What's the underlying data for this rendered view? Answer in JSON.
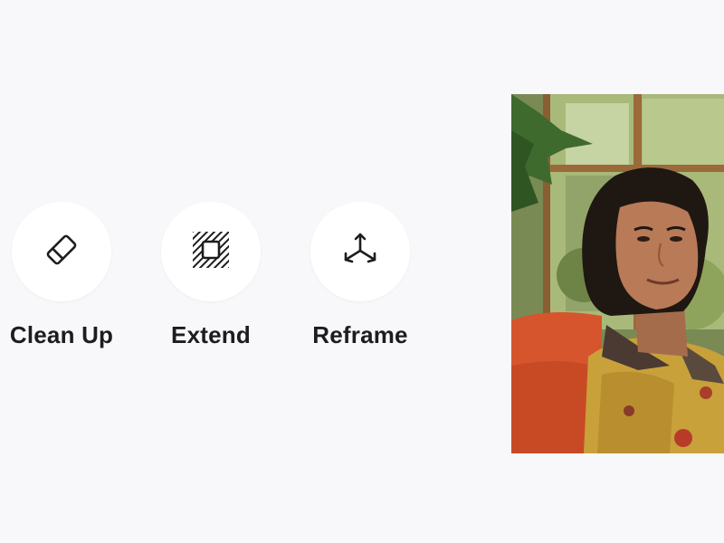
{
  "tools": [
    {
      "id": "clean-up",
      "label": "Clean Up",
      "icon": "eraser-icon"
    },
    {
      "id": "extend",
      "label": "Extend",
      "icon": "extend-frame-icon"
    },
    {
      "id": "reframe",
      "label": "Reframe",
      "icon": "reframe-3d-icon"
    }
  ],
  "colors": {
    "background": "#f8f7fa",
    "button": "#ffffff",
    "text": "#1d1d1f"
  }
}
